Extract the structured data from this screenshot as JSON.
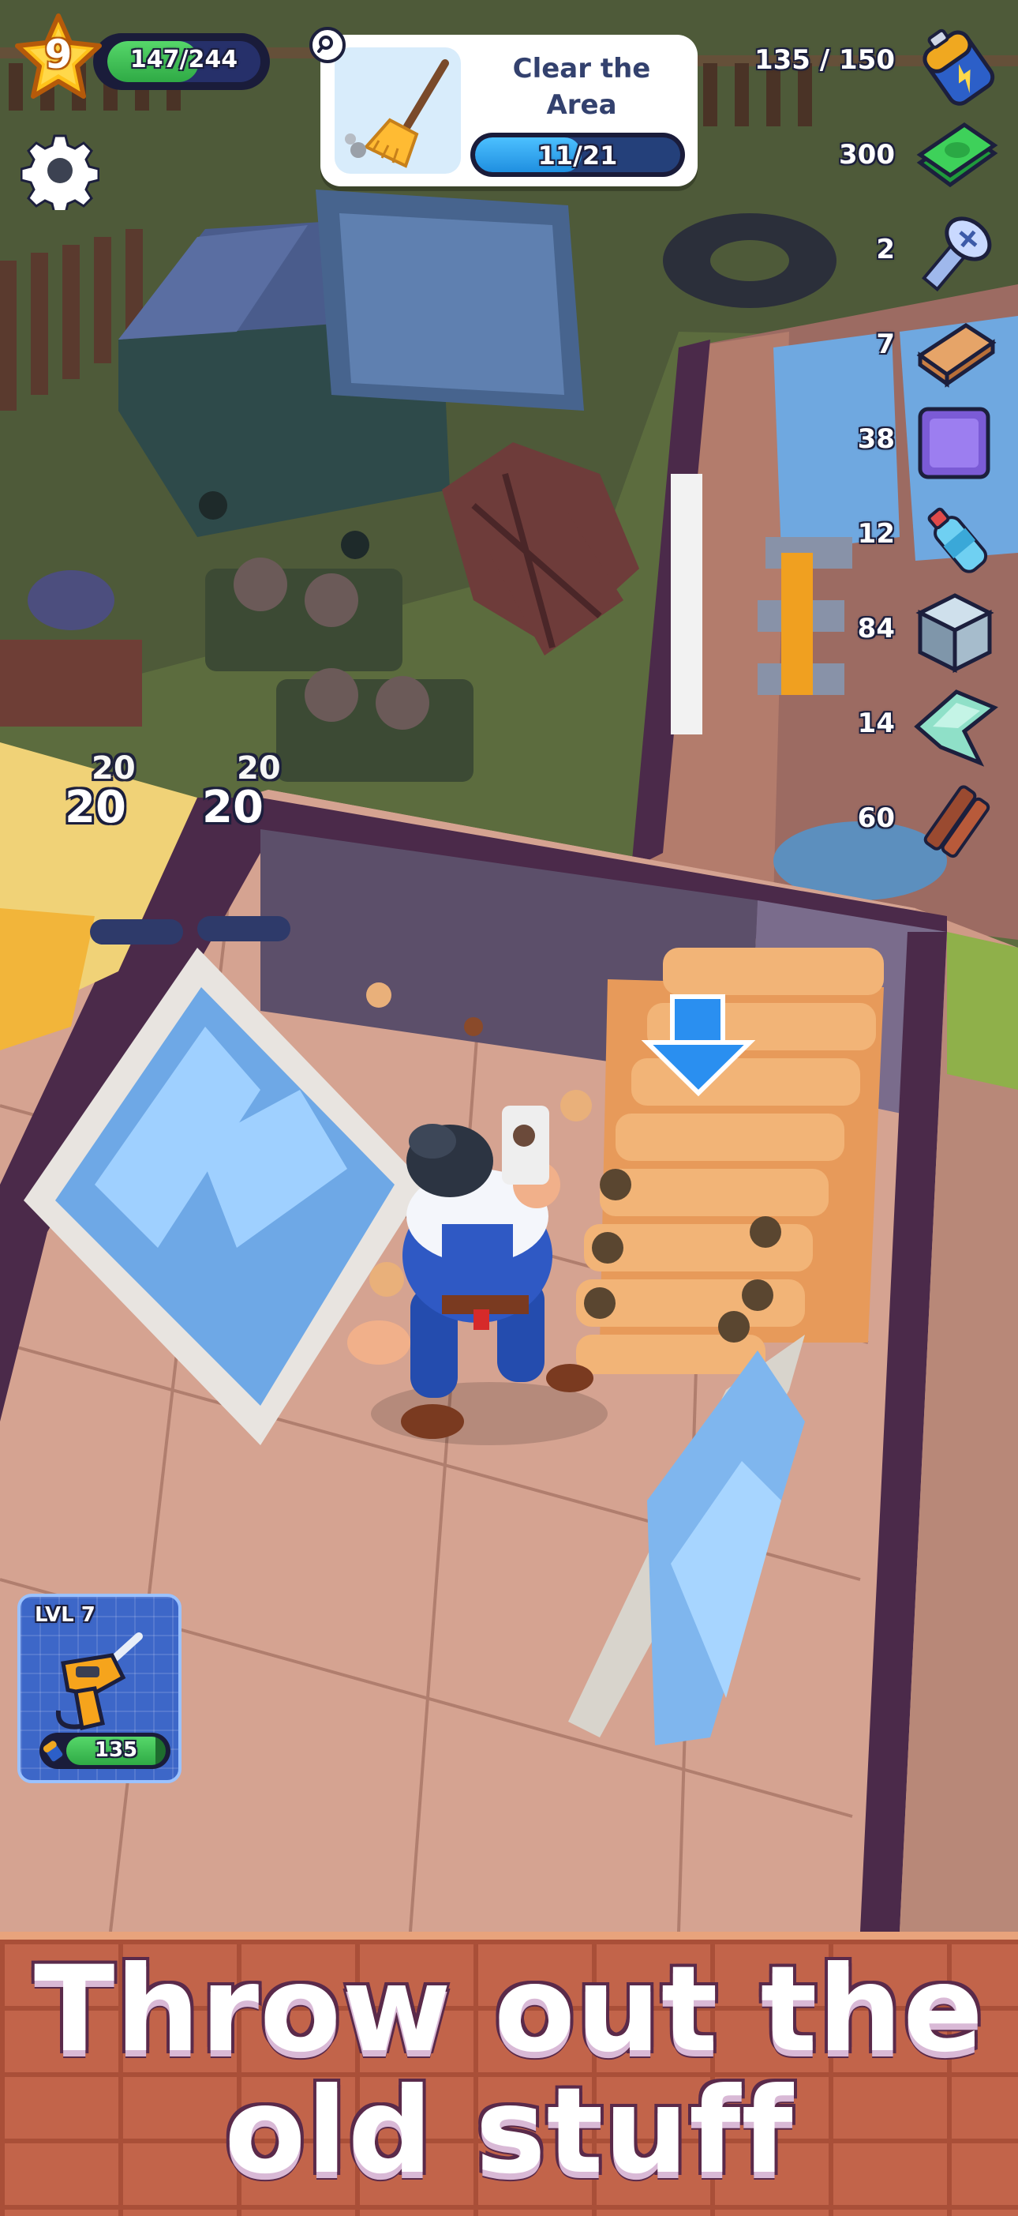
{
  "player": {
    "level": "9",
    "xp_text": "147/244",
    "xp_fraction": 0.6
  },
  "quest": {
    "title": "Clear the Area",
    "progress_text": "11/21",
    "progress_fraction": 0.52,
    "icon": "broom-icon"
  },
  "resources": [
    {
      "name": "energy",
      "count": "135 / 150",
      "icon": "battery-icon"
    },
    {
      "name": "cash",
      "count": "300",
      "icon": "cash-icon"
    },
    {
      "name": "screws",
      "count": "2",
      "icon": "screw-icon"
    },
    {
      "name": "bricks",
      "count": "7",
      "icon": "brick-icon"
    },
    {
      "name": "tiles",
      "count": "38",
      "icon": "tile-icon"
    },
    {
      "name": "plastic-bottles",
      "count": "12",
      "icon": "bottle-icon"
    },
    {
      "name": "metal-cubes",
      "count": "84",
      "icon": "cube-icon"
    },
    {
      "name": "glass-shards",
      "count": "14",
      "icon": "glass-icon"
    },
    {
      "name": "wood-planks",
      "count": "60",
      "icon": "plank-icon"
    }
  ],
  "floating_rewards": [
    "20",
    "20",
    "20",
    "20"
  ],
  "tool": {
    "level_label": "LVL 7",
    "energy": "135",
    "energy_fraction": 0.9,
    "icon": "drill-icon"
  },
  "banner": {
    "line1": "Throw out the",
    "line2": "old stuff"
  },
  "colors": {
    "xp_green": "#2faa45",
    "quest_blue": "#1f8fe0",
    "banner_brick": "#c2644a",
    "outline": "#1c1f3d"
  }
}
